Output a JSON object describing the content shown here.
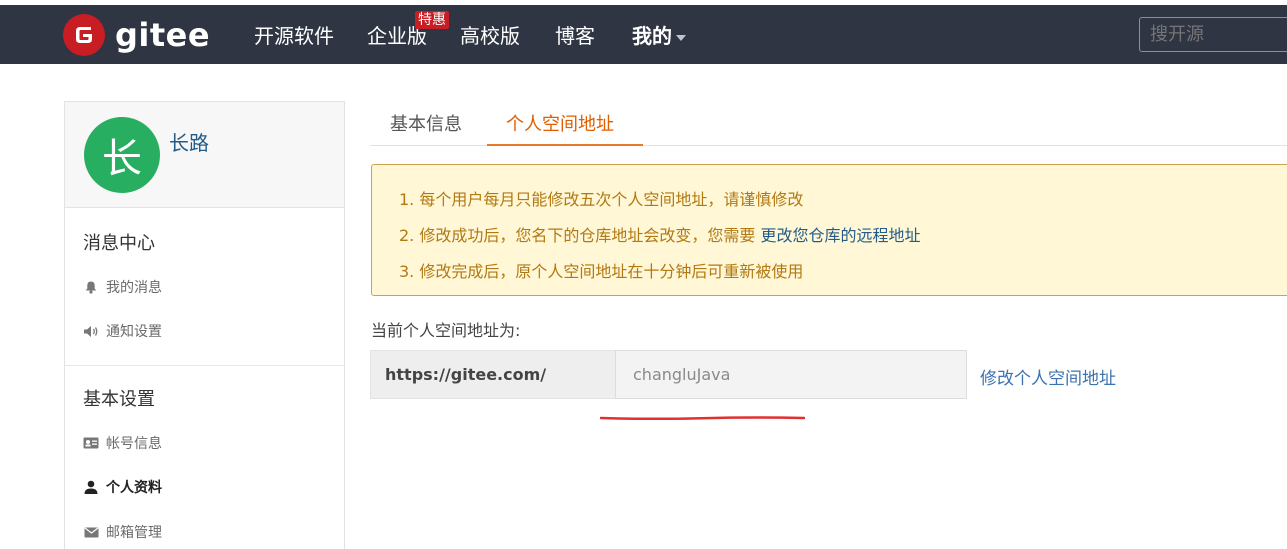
{
  "nav": {
    "logo_text": "gitee",
    "items": [
      "开源软件",
      "企业版",
      "高校版",
      "博客",
      "我的"
    ],
    "badge": "特惠",
    "search_placeholder": "搜开源"
  },
  "sidebar": {
    "username": "长路",
    "avatar_char": "长",
    "sections": [
      {
        "title": "消息中心",
        "items": [
          {
            "label": "我的消息",
            "icon": "bell-icon"
          },
          {
            "label": "通知设置",
            "icon": "volume-icon"
          }
        ]
      },
      {
        "title": "基本设置",
        "items": [
          {
            "label": "帐号信息",
            "icon": "id-card-icon"
          },
          {
            "label": "个人资料",
            "icon": "user-icon",
            "active": true
          },
          {
            "label": "邮箱管理",
            "icon": "envelope-icon"
          }
        ]
      }
    ]
  },
  "tabs": [
    {
      "label": "基本信息"
    },
    {
      "label": "个人空间地址",
      "active": true
    }
  ],
  "notice": {
    "line1": "1. 每个用户每月只能修改五次个人空间地址，请谨慎修改",
    "line2_prefix": "2. 修改成功后，您名下的仓库地址会改变，您需要 ",
    "line2_link": "更改您仓库的远程地址",
    "line3": "3. 修改完成后，原个人空间地址在十分钟后可重新被使用"
  },
  "address": {
    "label": "当前个人空间地址为:",
    "prefix": "https://gitee.com/",
    "value": "changluJava",
    "modify_link": "修改个人空间地址"
  },
  "colors": {
    "nav_bg": "#2f3542",
    "brand_red": "#c71d23",
    "avatar_green": "#27ae60",
    "tab_active": "#e05e00",
    "notice_bg": "#fff7d6",
    "notice_text": "#b27913",
    "link": "#3a73b0",
    "annotation_red": "#e03030"
  }
}
